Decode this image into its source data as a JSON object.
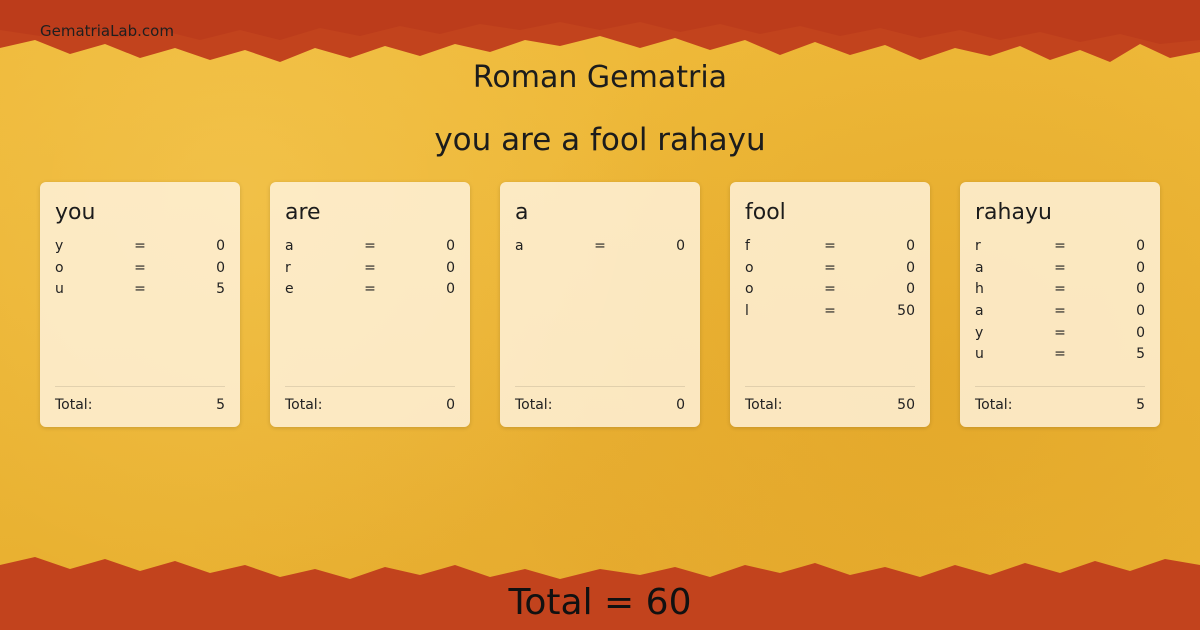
{
  "site_name": "GematriaLab.com",
  "cipher_title": "Roman Gematria",
  "phrase": "you are a fool rahayu",
  "colors": {
    "background": "#ecb535",
    "edge": "#c0401c",
    "card": "#fff4e0"
  },
  "total_label": "Total:",
  "equals": "=",
  "words": [
    {
      "word": "you",
      "total": "5",
      "letters": [
        {
          "letter": "y",
          "value": "0"
        },
        {
          "letter": "o",
          "value": "0"
        },
        {
          "letter": "u",
          "value": "5"
        }
      ]
    },
    {
      "word": "are",
      "total": "0",
      "letters": [
        {
          "letter": "a",
          "value": "0"
        },
        {
          "letter": "r",
          "value": "0"
        },
        {
          "letter": "e",
          "value": "0"
        }
      ]
    },
    {
      "word": "a",
      "total": "0",
      "letters": [
        {
          "letter": "a",
          "value": "0"
        }
      ]
    },
    {
      "word": "fool",
      "total": "50",
      "letters": [
        {
          "letter": "f",
          "value": "0"
        },
        {
          "letter": "o",
          "value": "0"
        },
        {
          "letter": "o",
          "value": "0"
        },
        {
          "letter": "l",
          "value": "50"
        }
      ]
    },
    {
      "word": "rahayu",
      "total": "5",
      "letters": [
        {
          "letter": "r",
          "value": "0"
        },
        {
          "letter": "a",
          "value": "0"
        },
        {
          "letter": "h",
          "value": "0"
        },
        {
          "letter": "a",
          "value": "0"
        },
        {
          "letter": "y",
          "value": "0"
        },
        {
          "letter": "u",
          "value": "5"
        }
      ]
    }
  ],
  "grand_total": "Total = 60"
}
